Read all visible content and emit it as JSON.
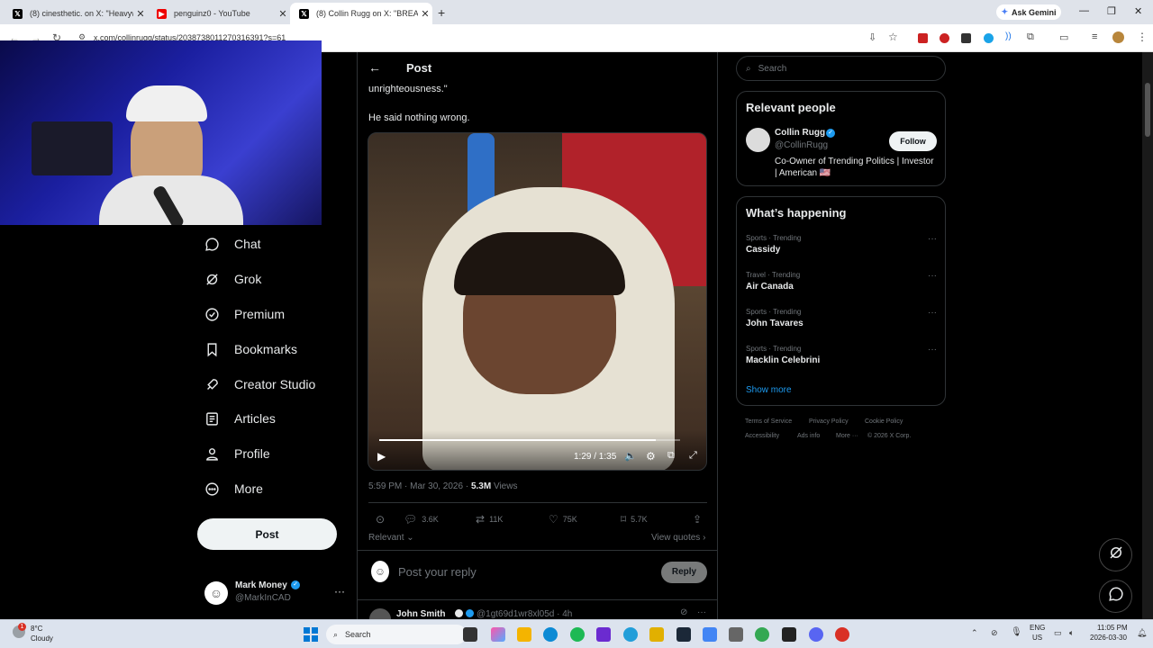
{
  "browser": {
    "tabs": [
      {
        "title": "(8) cinesthetic. on X: \"Heavywei",
        "favicon": "X"
      },
      {
        "title": "penguinz0 - YouTube",
        "favicon": "YT"
      },
      {
        "title": "(8) Collin Rugg on X: \"BREAKIN",
        "favicon": "X",
        "active": true
      }
    ],
    "url": "x.com/collinrugg/status/2038738011270316391?s=61",
    "ask_gemini": "Ask Gemini"
  },
  "nav": {
    "items": [
      {
        "label": "Chat",
        "icon": "chat-icon"
      },
      {
        "label": "Grok",
        "icon": "grok-icon"
      },
      {
        "label": "Premium",
        "icon": "premium-icon"
      },
      {
        "label": "Bookmarks",
        "icon": "bookmark-icon"
      },
      {
        "label": "Creator Studio",
        "icon": "rocket-icon"
      },
      {
        "label": "Articles",
        "icon": "articles-icon"
      },
      {
        "label": "Profile",
        "icon": "profile-icon"
      },
      {
        "label": "More",
        "icon": "more-circle-icon"
      }
    ],
    "post_button": "Post",
    "account": {
      "name": "Mark Money",
      "handle": "@MarkInCAD"
    }
  },
  "post": {
    "header": "Post",
    "text_partial": "unrighteousness.\"",
    "text_2": "He said nothing wrong.",
    "video": {
      "time": "1:29 / 1:35",
      "progress": 0.92
    },
    "timestamp": "5:59 PM · Mar 30, 2026 · ",
    "views_count": "5.3M",
    "views_label": "Views",
    "stats": {
      "replies": "3.6K",
      "reposts": "11K",
      "likes": "75K",
      "bookmarks": "5.7K"
    },
    "sort": "Relevant",
    "view_quotes": "View quotes",
    "reply_placeholder": "Post your reply",
    "reply_button": "Reply",
    "next_reply": {
      "name": "John Smith",
      "handle": "@1gt69d1wr8xl05d · 4h"
    }
  },
  "sidebar": {
    "search_placeholder": "Search",
    "relevant_people": {
      "title": "Relevant people",
      "name": "Collin Rugg",
      "handle": "@CollinRugg",
      "bio": "Co-Owner of Trending Politics | Investor | American 🇺🇸",
      "follow": "Follow"
    },
    "whats_happening": {
      "title": "What’s happening",
      "trends": [
        {
          "category": "Sports · Trending",
          "name": "Cassidy"
        },
        {
          "category": "Travel · Trending",
          "name": "Air Canada"
        },
        {
          "category": "Sports · Trending",
          "name": "John Tavares"
        },
        {
          "category": "Sports · Trending",
          "name": "Macklin Celebrini"
        }
      ],
      "show_more": "Show more"
    },
    "footer": [
      "Terms of Service",
      "Privacy Policy",
      "Cookie Policy",
      "Accessibility",
      "Ads info",
      "More ···",
      "© 2026 X Corp."
    ]
  },
  "taskbar": {
    "weather_temp": "8°C",
    "weather_desc": "Cloudy",
    "search": "Search",
    "lang": "ENG",
    "region": "US",
    "time": "11:05 PM",
    "date": "2026-03-30"
  }
}
